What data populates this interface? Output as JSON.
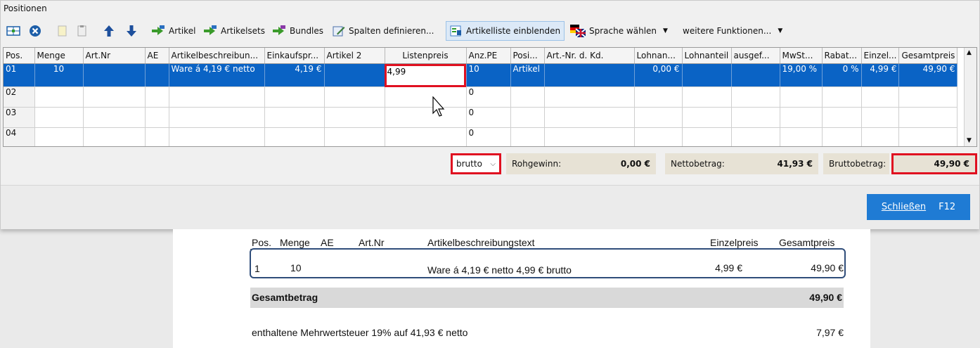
{
  "panel": {
    "title": "Positionen"
  },
  "toolbar": {
    "artikel": "Artikel",
    "artikelsets": "Artikelsets",
    "bundles": "Bundles",
    "spalten": "Spalten definieren...",
    "artikelliste": "Artikelliste einblenden",
    "sprache": "Sprache wählen",
    "weitere": "weitere Funktionen..."
  },
  "grid": {
    "headers": [
      "Pos.",
      "Menge",
      "Art.Nr",
      "AE",
      "Artikelbeschreibun...",
      "Einkaufspr...",
      "Artikel 2",
      "Listenpreis",
      "Anz.PE",
      "Posi...",
      "Art.-Nr. d. Kd.",
      "Lohnan...",
      "Lohnanteil",
      "ausgef...",
      "MwSt...",
      "Rabat...",
      "Einzel...",
      "Gesamtpreis"
    ],
    "rows": [
      [
        "01",
        "10",
        "",
        "",
        "Ware á 4,19 € netto",
        "4,19 €",
        "",
        "4,99",
        "10",
        "Artikel",
        "",
        "0,00 €",
        "",
        "",
        "19,00 %",
        "0 %",
        "4,99 €",
        "49,90 €"
      ],
      [
        "02",
        "",
        "",
        "",
        "",
        "",
        "",
        "",
        "0",
        "",
        "",
        "",
        "",
        "",
        "",
        "",
        "",
        ""
      ],
      [
        "03",
        "",
        "",
        "",
        "",
        "",
        "",
        "",
        "0",
        "",
        "",
        "",
        "",
        "",
        "",
        "",
        "",
        ""
      ],
      [
        "04",
        "",
        "",
        "",
        "",
        "",
        "",
        "",
        "0",
        "",
        "",
        "",
        "",
        "",
        "",
        "",
        "",
        ""
      ]
    ]
  },
  "summary": {
    "mode": "brutto",
    "rohgewinn_label": "Rohgewinn:",
    "rohgewinn": "0,00 €",
    "netto_label": "Nettobetrag:",
    "netto": "41,93 €",
    "brutto_label": "Bruttobetrag:",
    "brutto": "49,90 €"
  },
  "footer": {
    "close_label": "Schließen",
    "close_key": "F12"
  },
  "document": {
    "headers": {
      "pos": "Pos.",
      "menge": "Menge",
      "ae": "AE",
      "artnr": "Art.Nr",
      "desc": "Artikelbeschreibungstext",
      "einzel": "Einzelpreis",
      "gesamt": "Gesamtpreis"
    },
    "row": {
      "pos": "1",
      "menge": "10",
      "desc": "Ware á 4,19 € netto 4,99 € brutto",
      "einzel": "4,99 €",
      "gesamt": "49,90 €"
    },
    "total_label": "Gesamtbetrag",
    "total": "49,90 €",
    "tax_text": "enthaltene Mehrwertsteuer 19% auf 41,93 € netto",
    "tax": "7,97 €"
  },
  "colors": {
    "selection": "#0a63c5",
    "highlight": "#e01020",
    "button": "#1f7bd4"
  }
}
